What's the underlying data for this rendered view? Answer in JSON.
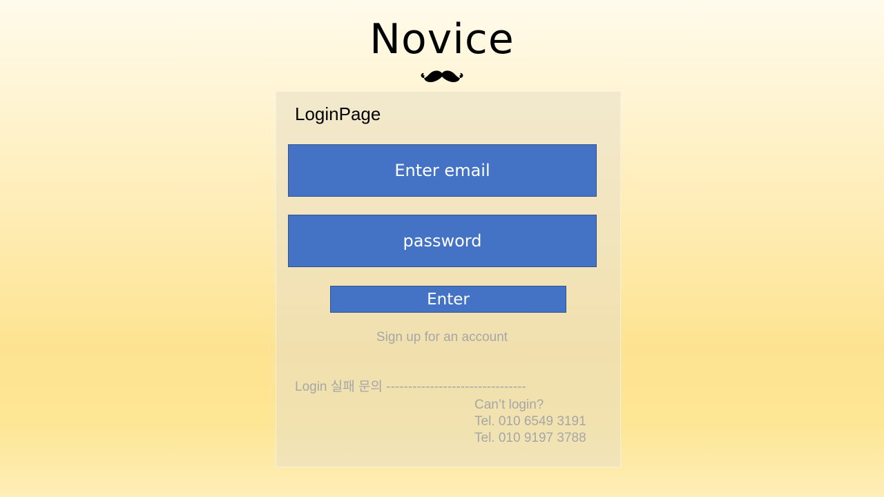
{
  "brand": {
    "title": "Novice",
    "logo_icon": "mustache-icon"
  },
  "login": {
    "title": "LoginPage",
    "email_placeholder": "Enter email",
    "password_placeholder": "password",
    "enter_label": "Enter",
    "signup_link": "Sign up for an account"
  },
  "support": {
    "inquiry_label": "Login 실패 문의 --------------------------------",
    "cant_login": "Can’t login?",
    "tel_1": "Tel. 010 6549 3191",
    "tel_2": "Tel. 010 9197 3788"
  },
  "colors": {
    "field_fill": "#4472c4",
    "field_border": "#2f528f",
    "muted_text": "#a6a6a6"
  }
}
